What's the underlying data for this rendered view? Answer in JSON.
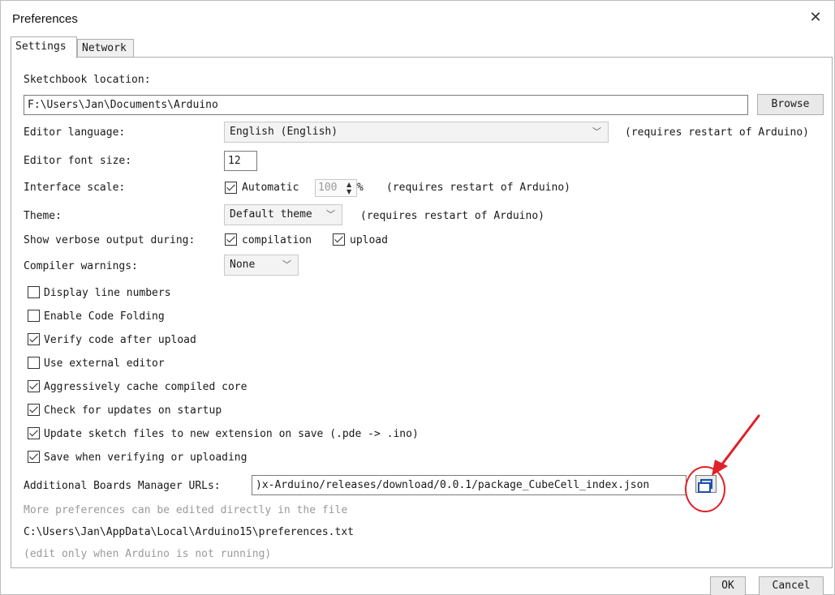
{
  "window": {
    "title": "Preferences"
  },
  "tabs": [
    {
      "label": "Settings",
      "active": true
    },
    {
      "label": "Network",
      "active": false
    }
  ],
  "settings": {
    "sketchbook_label": "Sketchbook location:",
    "sketchbook_value": "F:\\Users\\Jan\\Documents\\Arduino",
    "browse_label": "Browse",
    "editor_language_label": "Editor language:",
    "editor_language_value": "English (English)",
    "editor_language_note": "(requires restart of Arduino)",
    "font_size_label": "Editor font size:",
    "font_size_value": "12",
    "interface_scale_label": "Interface scale:",
    "automatic_label": "Automatic",
    "automatic_checked": true,
    "scale_value": "100",
    "scale_unit": "%",
    "interface_scale_note": "(requires restart of Arduino)",
    "theme_label": "Theme:",
    "theme_value": "Default theme",
    "theme_note": "(requires restart of Arduino)",
    "verbose_label": "Show verbose output during:",
    "verbose_compilation_label": "compilation",
    "verbose_upload_label": "upload",
    "compiler_warnings_label": "Compiler warnings:",
    "compiler_warnings_value": "None",
    "checkboxes": [
      {
        "label": "Display line numbers",
        "checked": false
      },
      {
        "label": "Enable Code Folding",
        "checked": false
      },
      {
        "label": "Verify code after upload",
        "checked": true
      },
      {
        "label": "Use external editor",
        "checked": false
      },
      {
        "label": "Aggressively cache compiled core",
        "checked": true
      },
      {
        "label": "Check for updates on startup",
        "checked": true
      },
      {
        "label": "Update sketch files to new extension on save (.pde -> .ino)",
        "checked": true
      },
      {
        "label": "Save when verifying or uploading",
        "checked": true
      }
    ],
    "boards_urls_label": "Additional Boards Manager URLs:",
    "boards_urls_value": ")x-Arduino/releases/download/0.0.1/package_CubeCell_index.json",
    "more_prefs_note": "More preferences can be edited directly in the file",
    "prefs_path": "C:\\Users\\Jan\\AppData\\Local\\Arduino15\\preferences.txt",
    "edit_note": "(edit only when Arduino is not running)"
  },
  "footer": {
    "ok_label": "OK",
    "cancel_label": "Cancel"
  },
  "colors": {
    "annotation": "#e0202a",
    "icon_blue": "#1e4fa8"
  }
}
